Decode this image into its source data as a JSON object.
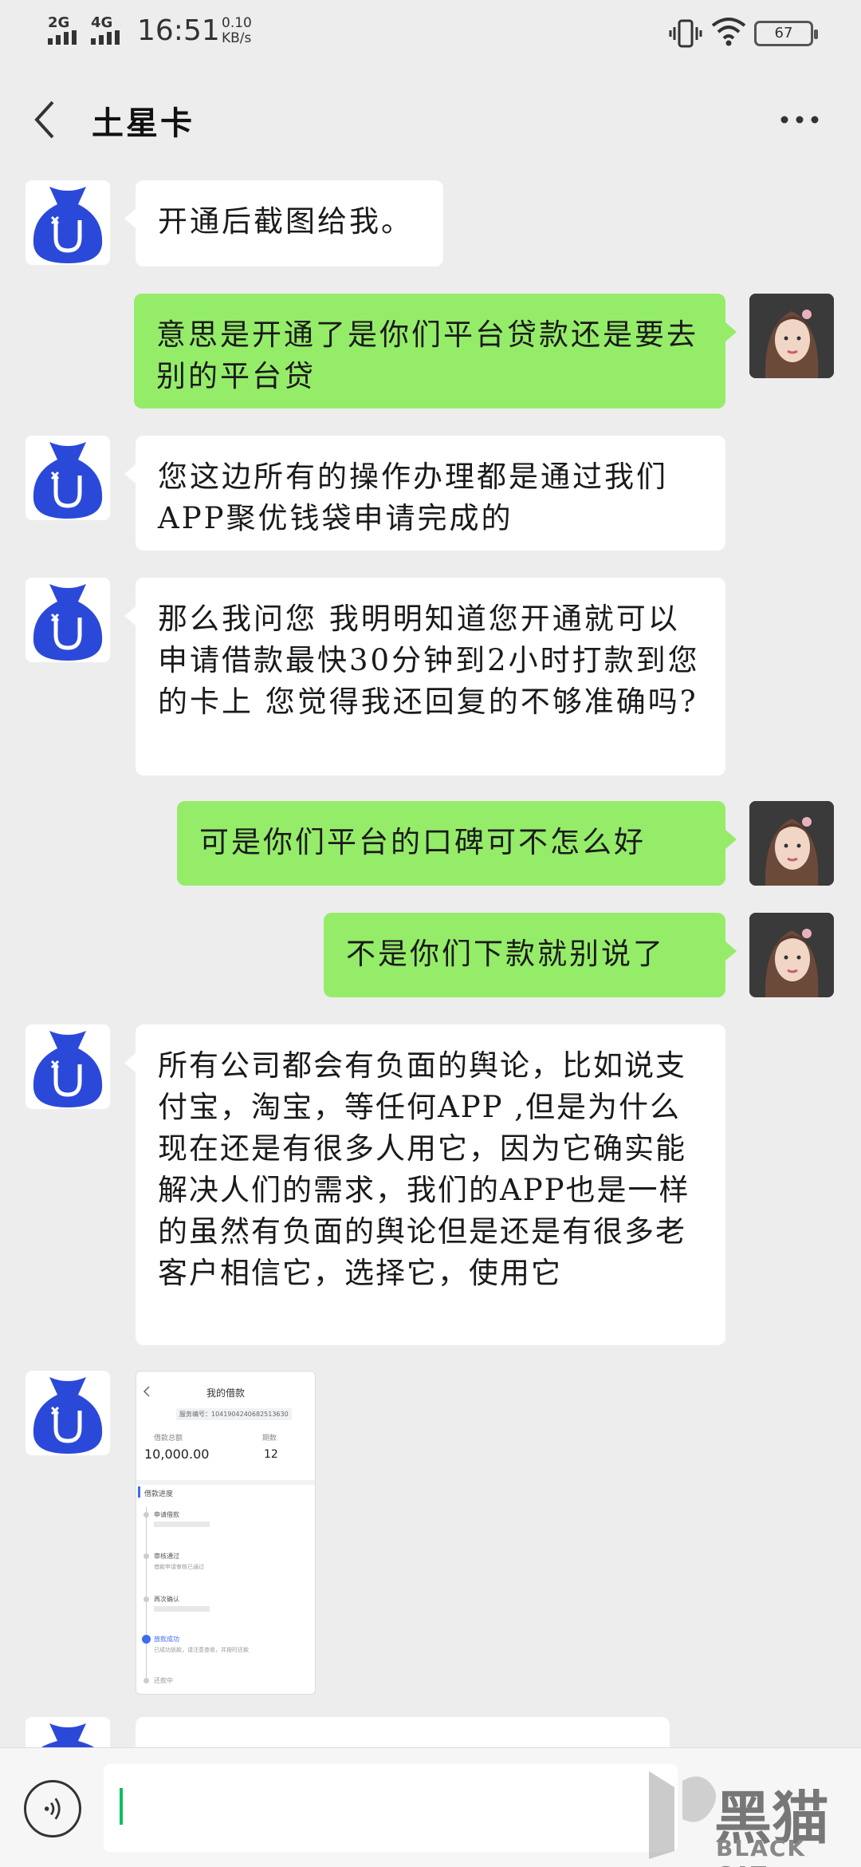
{
  "status": {
    "net1": "2G",
    "net2": "4G",
    "time": "16:51",
    "speed_value": "0.10",
    "speed_unit": "KB/s",
    "battery": "67"
  },
  "nav": {
    "title": "土星卡"
  },
  "messages": [
    {
      "side": "left",
      "text": "开通后截图给我。"
    },
    {
      "side": "right",
      "text": " 意思是开通了是你们平台贷款还是要去别的平台贷"
    },
    {
      "side": "left",
      "text": "您这边所有的操作办理都是通过我们APP聚优钱袋申请完成的"
    },
    {
      "side": "left",
      "text": "那么我问您 我明明知道您开通就可以申请借款最快30分钟到2小时打款到您的卡上 您觉得我还回复的不够准确吗?"
    },
    {
      "side": "right",
      "text": "可是你们平台的口碑可不怎么好"
    },
    {
      "side": "right",
      "text": "不是你们下款就别说了"
    },
    {
      "side": "left",
      "text": "所有公司都会有负面的舆论，比如说支付宝，淘宝，等任何APP ,但是为什么现在还是有很多人用它，因为它确实能解决人们的需求，我们的APP也是一样的虽然有负面的舆论但是还是有很多老客户相信它，选择它，使用它"
    }
  ],
  "loan_card": {
    "title": "我的借款",
    "order_label": "服务编号：1041904240682513630",
    "amount_label": "借款总额",
    "amount": "10,000.00",
    "term_label": "期数",
    "term": "12",
    "progress_title": "借款进度",
    "steps": [
      "申请借款",
      "审核通过",
      "再次确认",
      "放款成功",
      "还款中"
    ],
    "step_notes": [
      "借款申请审核已通过",
      "已成功放款，请注意查收，并按时还款"
    ]
  },
  "watermark": {
    "big": "黑猫",
    "small": "BLACK CAT"
  },
  "colors": {
    "bubble_right": "#95ec69",
    "bubble_left": "#ffffff",
    "background": "#ededed",
    "bot_avatar": "#2b49d9"
  },
  "icons": {
    "back": "chevron-left-icon",
    "more": "more-dots-icon",
    "voice": "voice-icon"
  }
}
